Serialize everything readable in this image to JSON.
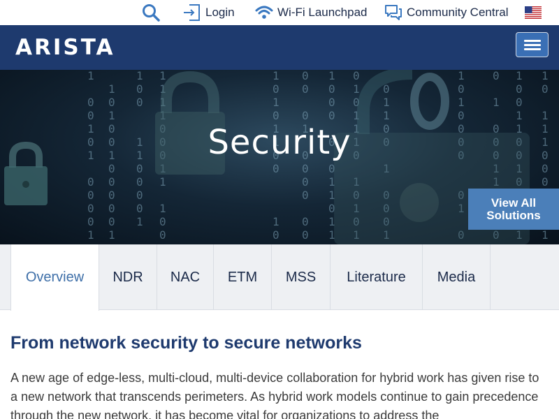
{
  "utility": {
    "search_icon": "search-icon",
    "login_label": "Login",
    "wifi_label": "Wi-Fi Launchpad",
    "community_label": "Community Central",
    "flag_icon": "us-flag-icon"
  },
  "header": {
    "logo_text": "ARISTA",
    "menu_icon": "hamburger-menu-icon",
    "bg_color": "#1e3a6e"
  },
  "hero": {
    "title": "Security",
    "view_all_line1": "View All",
    "view_all_line2": "Solutions",
    "button_color": "#4b7fb9"
  },
  "tabs": [
    {
      "label": "Overview",
      "active": true
    },
    {
      "label": "NDR"
    },
    {
      "label": "NAC"
    },
    {
      "label": "ETM"
    },
    {
      "label": "MSS"
    },
    {
      "label": "Literature"
    },
    {
      "label": "Media"
    }
  ],
  "content": {
    "heading": "From network security to secure networks",
    "body": "A new age of edge-less, multi-cloud, multi-device collaboration for hybrid work has given rise to a new network that transcends perimeters. As hybrid work models continue to gain precedence through the new network, it has become vital for organizations to address the",
    "accent_color": "#3e6fa8"
  }
}
